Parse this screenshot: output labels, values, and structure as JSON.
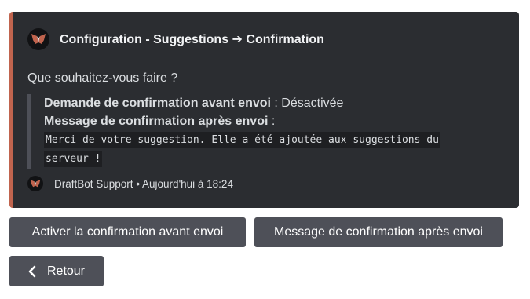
{
  "embed": {
    "accent_color": "#c0644e",
    "author_icon": "draftbot-logo-icon",
    "title": "Configuration - Suggestions ➔ Confirmation",
    "description": "Que souhaitez-vous faire ?",
    "field_1_label": "Demande de confirmation avant envoi",
    "field_1_sep": " : ",
    "field_1_value": "Désactivée",
    "field_2_label": "Message de confirmation après envoi",
    "field_2_sep": " :",
    "code_text": "Merci de votre suggestion. Elle a été ajoutée aux suggestions du serveur !",
    "footer_text": "DraftBot Support • Aujourd'hui à 18:24"
  },
  "buttons": {
    "enable_confirmation": "Activer la confirmation avant envoi",
    "confirmation_message": "Message de confirmation après envoi",
    "back": "Retour",
    "back_icon": "chevron-left-icon",
    "color": "#4e5058"
  }
}
